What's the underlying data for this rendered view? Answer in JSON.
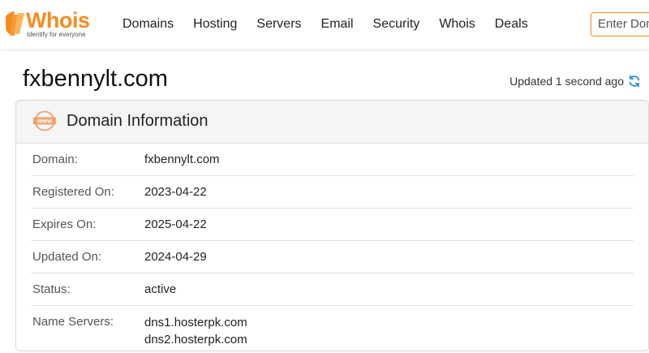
{
  "brand": {
    "name": "Whois",
    "tagline": "Identify for everyone",
    "accent_color": "#f68c1f"
  },
  "nav": {
    "items": [
      "Domains",
      "Hosting",
      "Servers",
      "Email",
      "Security",
      "Whois",
      "Deals"
    ]
  },
  "search": {
    "placeholder": "Enter Domain"
  },
  "page": {
    "title": "fxbennylt.com",
    "updated_text": "Updated 1 second ago",
    "refresh_icon": "refresh-icon"
  },
  "card": {
    "title": "Domain Information",
    "icon": "www-icon",
    "rows": [
      {
        "label": "Domain:",
        "value": "fxbennylt.com"
      },
      {
        "label": "Registered On:",
        "value": "2023-04-22"
      },
      {
        "label": "Expires On:",
        "value": "2025-04-22"
      },
      {
        "label": "Updated On:",
        "value": "2024-04-29"
      },
      {
        "label": "Status:",
        "value": "active"
      }
    ],
    "name_servers": {
      "label": "Name Servers:",
      "values": [
        "dns1.hosterpk.com",
        "dns2.hosterpk.com"
      ]
    }
  }
}
